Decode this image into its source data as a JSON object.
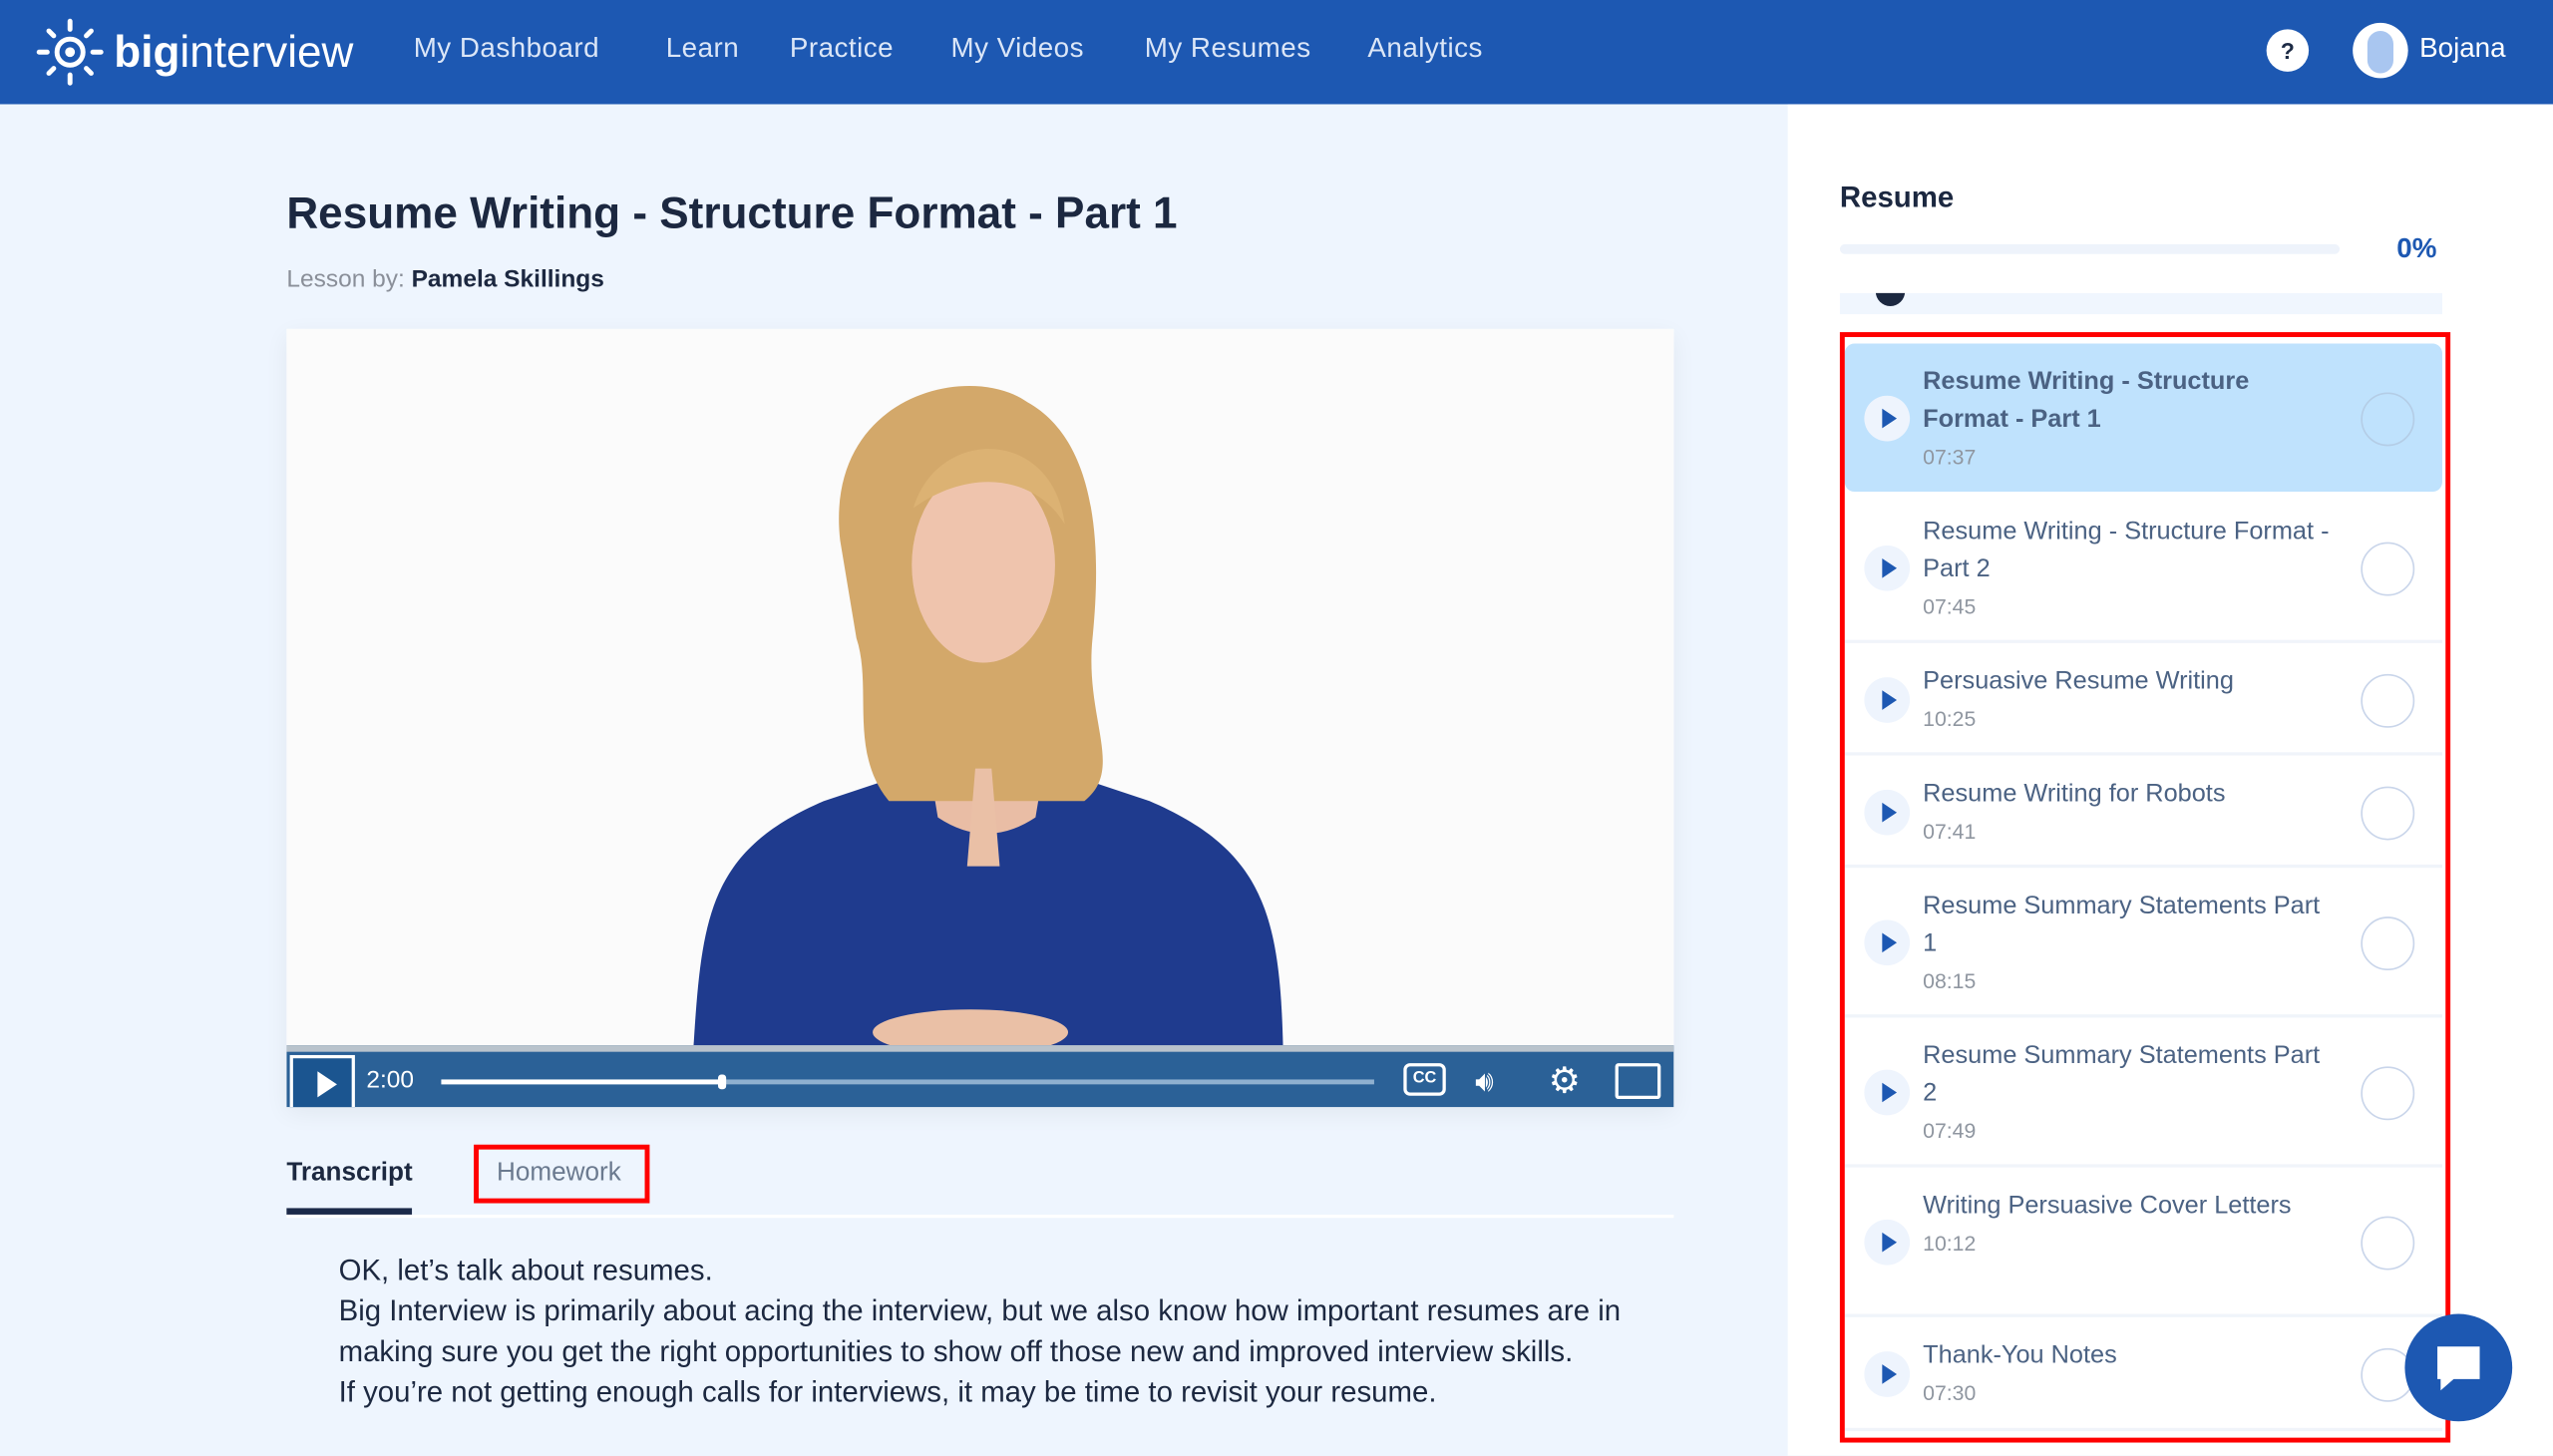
{
  "header": {
    "logo_bold": "big",
    "logo_light": "interview",
    "nav": [
      "My Dashboard",
      "Learn",
      "Practice",
      "My Videos",
      "My Resumes",
      "Analytics"
    ],
    "help_label": "?",
    "user_name": "Bojana"
  },
  "lesson": {
    "title": "Resume Writing - Structure Format - Part 1",
    "byline_label": "Lesson by:",
    "author": "Pamela Skillings"
  },
  "player": {
    "current_time": "2:00",
    "progress_percent": 30,
    "cc_label": "CC"
  },
  "tabs": [
    {
      "label": "Transcript",
      "active": true
    },
    {
      "label": "Homework",
      "active": false
    }
  ],
  "transcript": [
    "OK, let’s talk about resumes.",
    "Big Interview is primarily about acing the interview, but we also know how important resumes are in making sure you get the right opportunities to show off those new and improved interview skills.",
    "If you’re not getting enough calls for interviews, it may be time to revisit your resume."
  ],
  "sidebar": {
    "title": "Resume",
    "progress": "0%",
    "lessons": [
      {
        "title": "Resume Writing - Structure Format - Part 1",
        "duration": "07:37",
        "active": true
      },
      {
        "title": "Resume Writing - Structure Format - Part 2",
        "duration": "07:45"
      },
      {
        "title": "Persuasive Resume Writing",
        "duration": "10:25"
      },
      {
        "title": "Resume Writing for Robots",
        "duration": "07:41"
      },
      {
        "title": "Resume Summary Statements Part 1",
        "duration": "08:15"
      },
      {
        "title": "Resume Summary Statements Part 2",
        "duration": "07:49"
      },
      {
        "title": "Writing Persuasive Cover Letters",
        "duration": "10:12"
      },
      {
        "title": "Thank-You Notes",
        "duration": "07:30"
      }
    ]
  },
  "colors": {
    "brand": "#1d58b2",
    "active_item": "#bfe2fd",
    "highlight": "#ff0000"
  }
}
